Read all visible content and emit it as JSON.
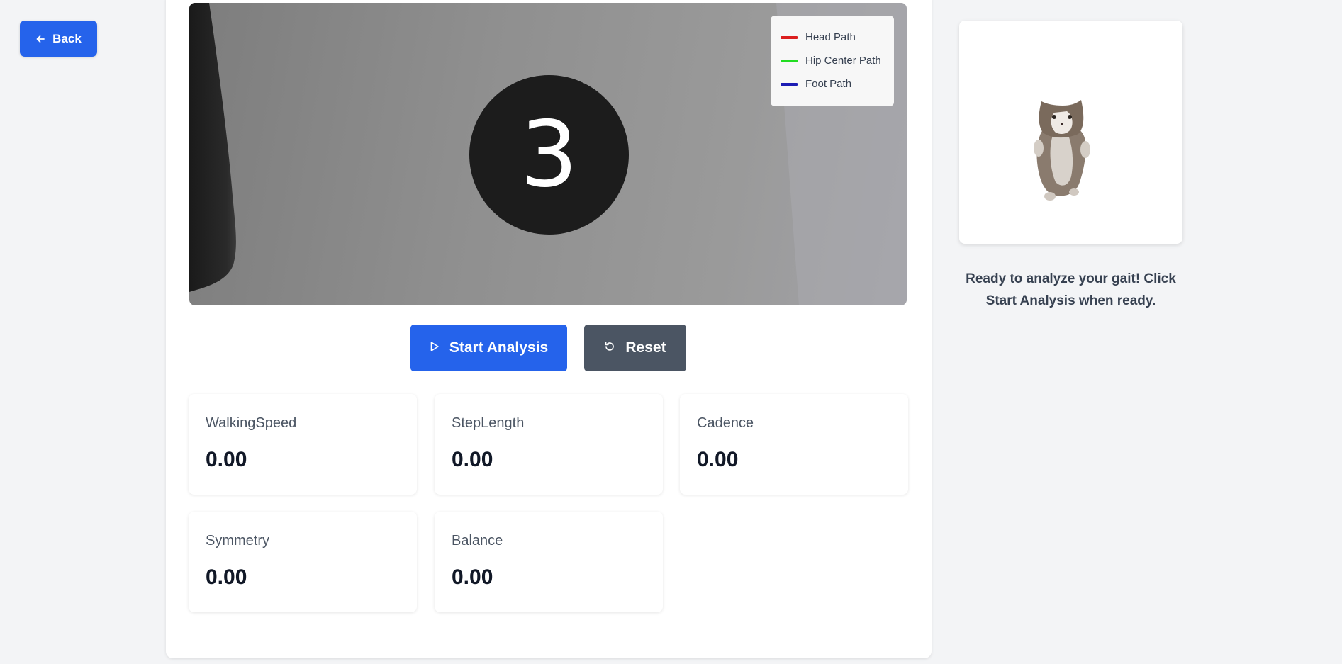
{
  "nav": {
    "back_label": "Back",
    "back_icon": "arrow-left-icon"
  },
  "video": {
    "countdown": "3",
    "legend": [
      {
        "label": "Head Path",
        "color": "#dc1f1f"
      },
      {
        "label": "Hip Center Path",
        "color": "#22dd22"
      },
      {
        "label": "Foot Path",
        "color": "#1c1cb4"
      }
    ]
  },
  "controls": {
    "start_label": "Start Analysis",
    "start_icon": "play-icon",
    "reset_label": "Reset",
    "reset_icon": "rotate-ccw-icon"
  },
  "metrics": [
    {
      "label": "WalkingSpeed",
      "value": "0.00"
    },
    {
      "label": "StepLength",
      "value": "0.00"
    },
    {
      "label": "Cadence",
      "value": "0.00"
    },
    {
      "label": "Symmetry",
      "value": "0.00"
    },
    {
      "label": "Balance",
      "value": "0.00"
    }
  ],
  "assistant": {
    "image": "cat-figure",
    "status": "Ready to analyze your gait! Click Start Analysis when ready."
  },
  "colors": {
    "primary": "#2563eb",
    "secondary": "#4b5563",
    "background": "#f3f4f6"
  }
}
